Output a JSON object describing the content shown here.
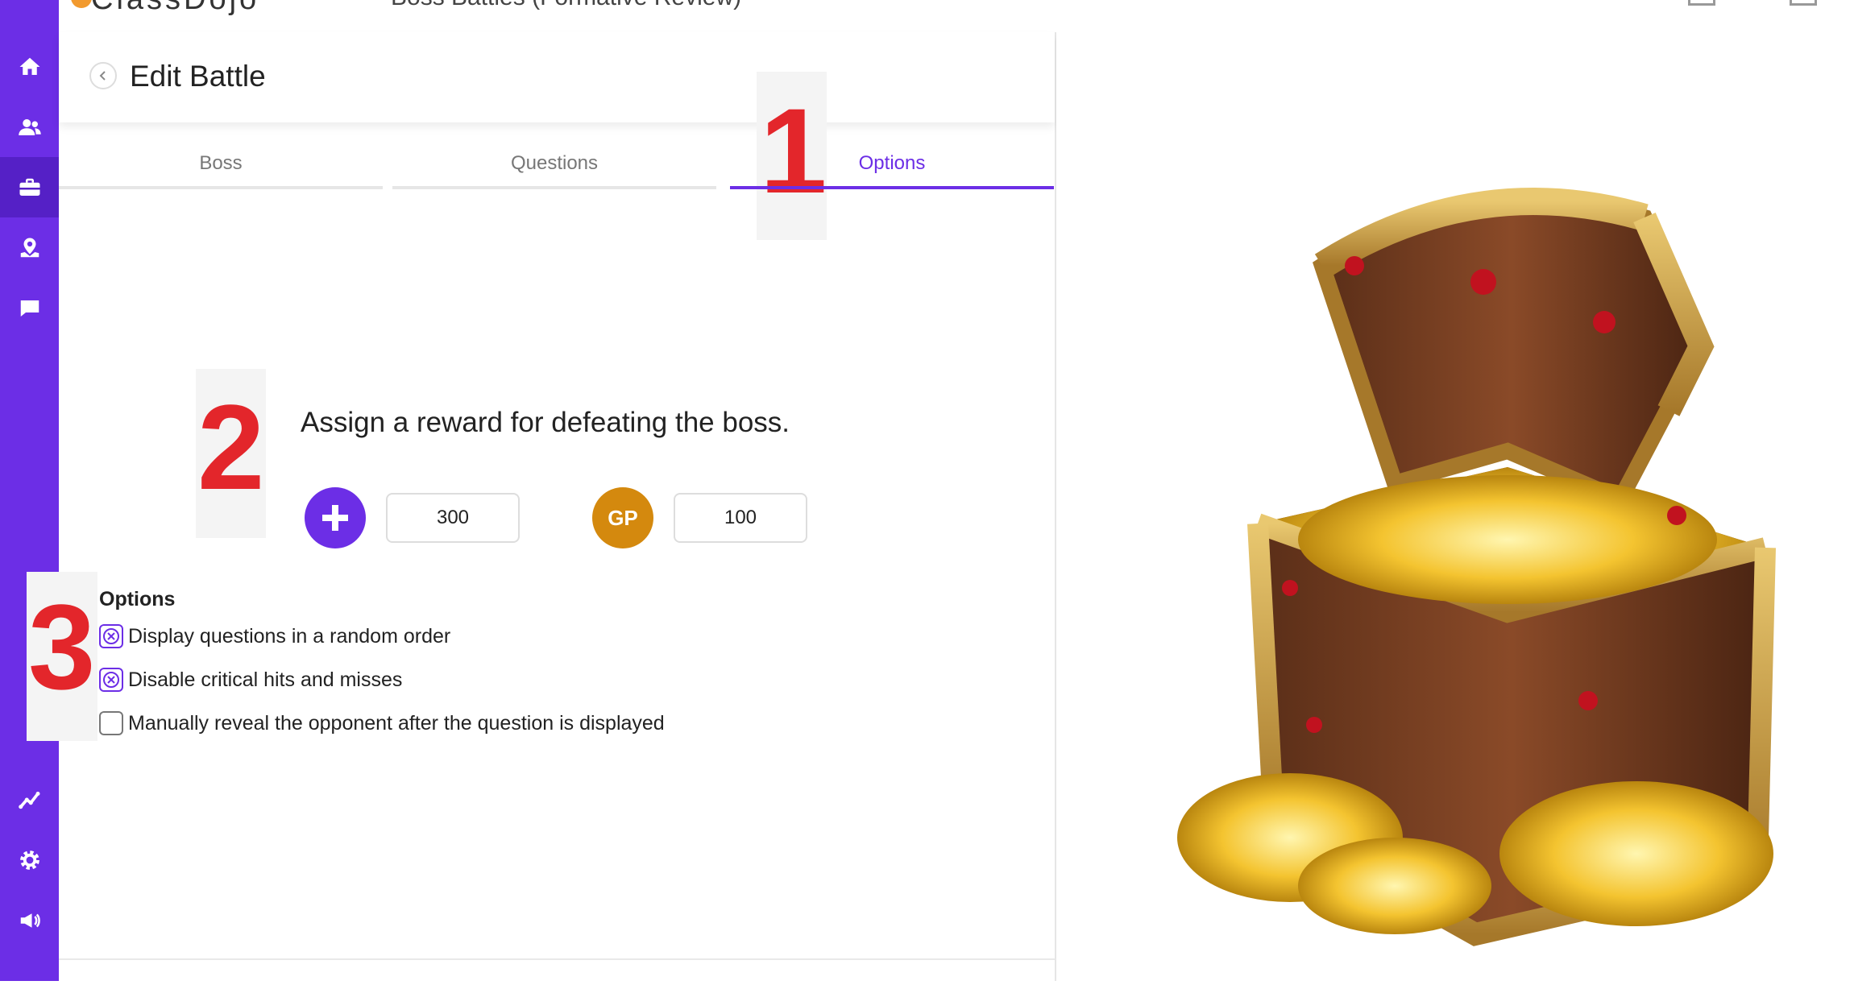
{
  "topbar": {
    "brand": "ClassDojo",
    "breadcrumb": "Boss Battles (Formative Review)"
  },
  "sidebar": {
    "items": [
      {
        "icon": "home-icon"
      },
      {
        "icon": "users-icon"
      },
      {
        "icon": "briefcase-icon",
        "active": true
      },
      {
        "icon": "map-pin-icon"
      },
      {
        "icon": "chat-icon"
      },
      {
        "icon": "chart-icon"
      },
      {
        "icon": "gear-icon"
      },
      {
        "icon": "megaphone-icon"
      }
    ]
  },
  "header": {
    "title": "Edit Battle"
  },
  "tabs": [
    {
      "label": "Boss"
    },
    {
      "label": "Questions"
    },
    {
      "label": "Options",
      "active": true
    }
  ],
  "markers": [
    "1",
    "2",
    "3"
  ],
  "reward": {
    "title": "Assign a reward for defeating the boss.",
    "xp_value": "300",
    "gp_label": "GP",
    "gp_value": "100"
  },
  "options": {
    "title": "Options",
    "items": [
      {
        "label": "Display questions in a random order",
        "checked": true
      },
      {
        "label": "Disable critical hits and misses",
        "checked": true
      },
      {
        "label": "Manually reveal the opponent after the question is displayed",
        "checked": false
      }
    ]
  },
  "colors": {
    "accent": "#6c2ee6",
    "gold": "#d4890e",
    "marker": "#e3262b"
  }
}
